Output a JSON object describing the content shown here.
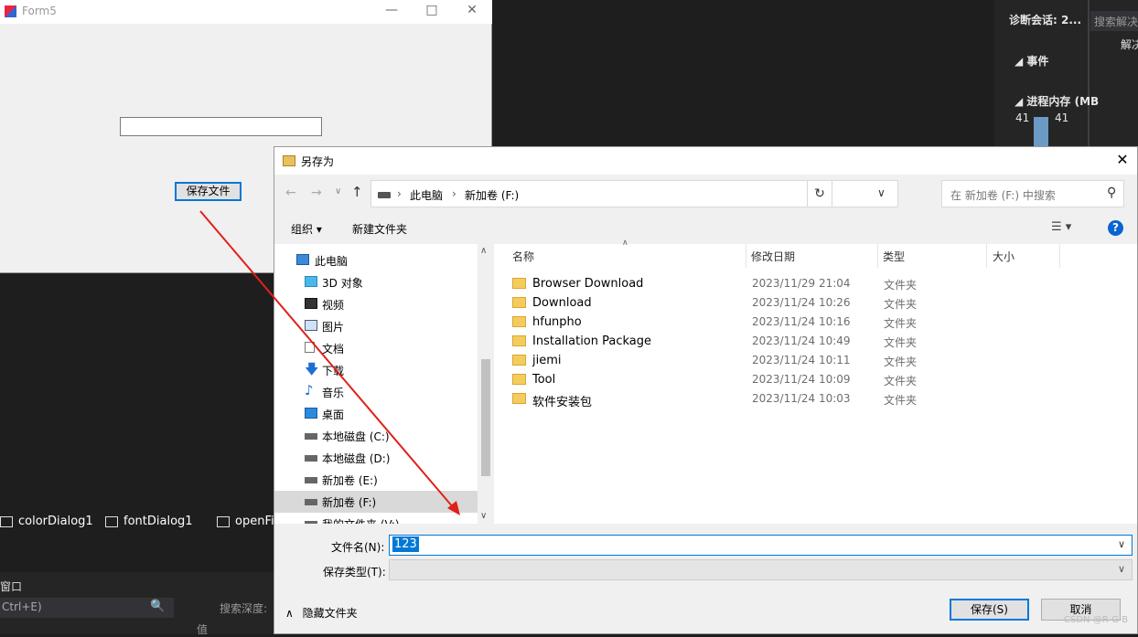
{
  "ide": {
    "diag_title": "诊断会话: 2...",
    "diag_search": "搜索解决",
    "events_label": "◢ 事件",
    "memory_label": "◢ 进程内存 (MB",
    "memory_v1": "41",
    "memory_v2": "41",
    "solution_label": "解决",
    "tray": {
      "color_dialog": "colorDialog1",
      "font_dialog": "fontDialog1",
      "open_file": "openFil"
    },
    "panel_title": "窗口",
    "panel_input": "Ctrl+E)",
    "panel_depth": "搜索深度:",
    "panel_value": "值"
  },
  "form5": {
    "title": "Form5",
    "textbox_value": "",
    "save_button": "保存文件"
  },
  "dialog": {
    "title": "另存为",
    "address": {
      "crumbs": [
        "此电脑",
        "新加卷 (F:)"
      ]
    },
    "search_placeholder": "在 新加卷 (F:) 中搜索",
    "toolbar": {
      "organize": "组织 ▾",
      "new_folder": "新建文件夹"
    },
    "nav_items": [
      {
        "label": "此电脑",
        "icon": "computer-icon"
      },
      {
        "label": "3D 对象",
        "icon": "cube-3d-icon"
      },
      {
        "label": "视频",
        "icon": "video-icon"
      },
      {
        "label": "图片",
        "icon": "picture-icon"
      },
      {
        "label": "文档",
        "icon": "document-icon"
      },
      {
        "label": "下载",
        "icon": "download-icon"
      },
      {
        "label": "音乐",
        "icon": "music-icon"
      },
      {
        "label": "桌面",
        "icon": "desktop-icon"
      },
      {
        "label": "本地磁盘 (C:)",
        "icon": "drive-icon"
      },
      {
        "label": "本地磁盘 (D:)",
        "icon": "drive-icon"
      },
      {
        "label": "新加卷 (E:)",
        "icon": "drive-icon"
      },
      {
        "label": "新加卷 (F:)",
        "icon": "drive-icon",
        "selected": true
      },
      {
        "label": "我的文件夹 (V:)",
        "icon": "drive-icon"
      }
    ],
    "columns": {
      "name": "名称",
      "date": "修改日期",
      "type": "类型",
      "size": "大小"
    },
    "files": [
      {
        "name": "Browser Download",
        "date": "2023/11/29 21:04",
        "type": "文件夹"
      },
      {
        "name": "Download",
        "date": "2023/11/24 10:26",
        "type": "文件夹"
      },
      {
        "name": "hfunpho",
        "date": "2023/11/24 10:16",
        "type": "文件夹"
      },
      {
        "name": "Installation Package",
        "date": "2023/11/24 10:49",
        "type": "文件夹"
      },
      {
        "name": "jiemi",
        "date": "2023/11/24 10:11",
        "type": "文件夹"
      },
      {
        "name": "Tool",
        "date": "2023/11/24 10:09",
        "type": "文件夹"
      },
      {
        "name": "软件安装包",
        "date": "2023/11/24 10:03",
        "type": "文件夹"
      }
    ],
    "filename_label": "文件名(N):",
    "filename_value": "123",
    "filetype_label": "保存类型(T):",
    "filetype_value": "",
    "hide_folders": "隐藏文件夹",
    "save_button": "保存(S)",
    "cancel_button": "取消"
  },
  "watermark": "CSDN @R-G-B",
  "colors": {
    "accent": "#0078d7",
    "ide_bg": "#1e1e1e",
    "annotation_arrow": "#e0201a"
  }
}
